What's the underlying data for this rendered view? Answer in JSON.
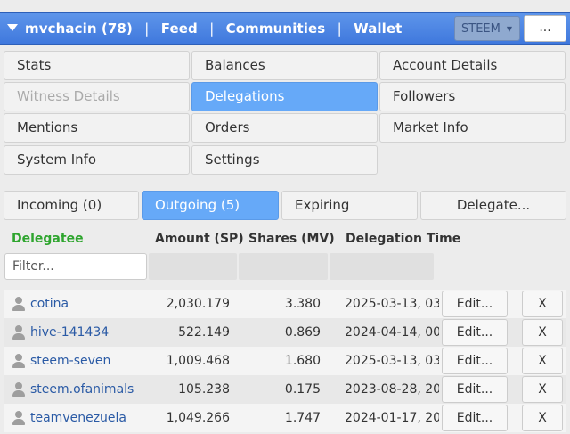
{
  "header": {
    "account": "mvchacin (78)",
    "links": [
      "Feed",
      "Communities",
      "Wallet"
    ],
    "separator": "|",
    "currency": "STEEM",
    "more": "..."
  },
  "menu": [
    {
      "label": "Stats",
      "state": "normal"
    },
    {
      "label": "Balances",
      "state": "normal"
    },
    {
      "label": "Account Details",
      "state": "normal"
    },
    {
      "label": "Witness Details",
      "state": "disabled"
    },
    {
      "label": "Delegations",
      "state": "active"
    },
    {
      "label": "Followers",
      "state": "normal"
    },
    {
      "label": "Mentions",
      "state": "normal"
    },
    {
      "label": "Orders",
      "state": "normal"
    },
    {
      "label": "Market Info",
      "state": "normal"
    },
    {
      "label": "System Info",
      "state": "normal"
    },
    {
      "label": "Settings",
      "state": "normal"
    }
  ],
  "tabs": [
    {
      "label": "Incoming (0)",
      "state": "normal"
    },
    {
      "label": "Outgoing (5)",
      "state": "active"
    },
    {
      "label": "Expiring",
      "state": "normal"
    },
    {
      "label": "Delegate...",
      "state": "normal"
    }
  ],
  "table": {
    "headers": [
      "Delegatee",
      "Amount (SP)",
      "Shares (MV)",
      "Delegation Time"
    ],
    "filter_placeholder": "Filter...",
    "edit_label": "Edit...",
    "remove_label": "X",
    "rows": [
      {
        "name": "cotina",
        "amount": "2,030.179",
        "shares": "3.380",
        "time": "2025-03-13, 03:"
      },
      {
        "name": "hive-141434",
        "amount": "522.149",
        "shares": "0.869",
        "time": "2024-04-14, 00:"
      },
      {
        "name": "steem-seven",
        "amount": "1,009.468",
        "shares": "1.680",
        "time": "2025-03-13, 03:"
      },
      {
        "name": "steem.ofanimals",
        "amount": "105.238",
        "shares": "0.175",
        "time": "2023-08-28, 20:"
      },
      {
        "name": "teamvenezuela",
        "amount": "1,049.266",
        "shares": "1.747",
        "time": "2024-01-17, 20:"
      }
    ]
  },
  "colors": {
    "header": "#3f78dd",
    "active": "#66a9f8",
    "delegatee_header": "#2ea52e",
    "link": "#2a5aa5"
  },
  "icons": {
    "menu_toggle": "caret-down-icon",
    "user": "user-icon"
  }
}
